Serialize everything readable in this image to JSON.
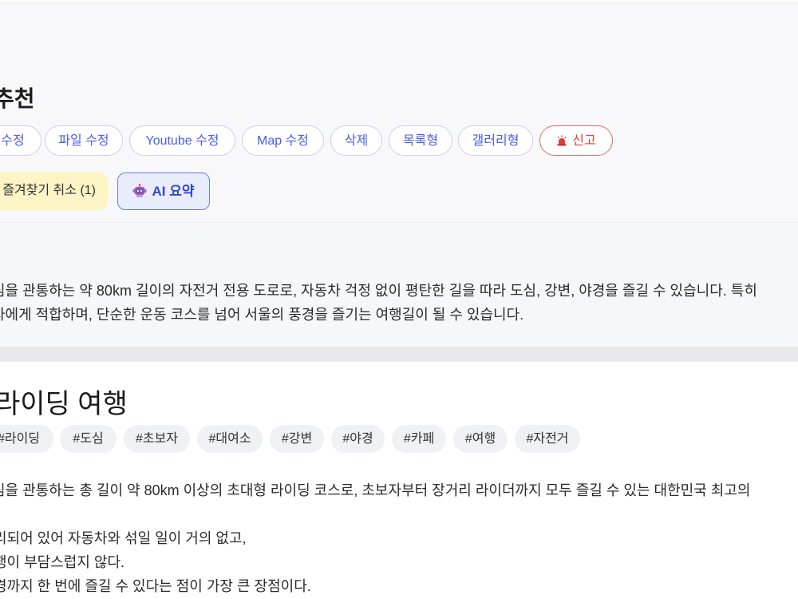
{
  "post": {
    "title": "추천"
  },
  "actions": [
    {
      "label": "수정",
      "style": "blue"
    },
    {
      "label": "파일 수정",
      "style": "blue"
    },
    {
      "label": "Youtube 수정",
      "style": "blue"
    },
    {
      "label": "Map 수정",
      "style": "blue"
    },
    {
      "label": "삭제",
      "style": "blue"
    },
    {
      "label": "목록형",
      "style": "blue"
    },
    {
      "label": "갤러리형",
      "style": "blue"
    },
    {
      "label": "신고",
      "style": "red",
      "icon": "siren-icon"
    }
  ],
  "favorite": {
    "label": "즐겨찾기 취소 (1)"
  },
  "ai_summary": {
    "label": "AI 요약",
    "icon": "robot-icon"
  },
  "summary_lines": [
    "심을 관통하는 약 80km 길이의 자전거 전용 도로로, 자동차 걱정 없이 평탄한 길을 따라 도심, 강변, 야경을 즐길 수 있습니다. 특히",
    "자에게 적합하며, 단순한 운동 코스를 넘어 서울의 풍경을 즐기는 여행길이 될 수 있습니다."
  ],
  "article": {
    "title": "라이딩 여행",
    "tags": [
      "#라이딩",
      "#도심",
      "#초보자",
      "#대여소",
      "#강변",
      "#야경",
      "#카페",
      "#여행",
      "#자전거"
    ],
    "lines": [
      "심을 관통하는 총 길이 약 80km 이상의 초대형 라이딩 코스로, 초보자부터 장거리 라이더까지 모두 즐길 수 있는 대한민국 최고의",
      "리되어 있어 자동차와 섞일 일이 거의 없고,",
      "행이 부담스럽지 않다.",
      "경까지 한 번에 즐길 수 있다는 점이 가장 큰 장점이다."
    ]
  },
  "colors": {
    "accent": "#4a5de8",
    "report": "#e23c3c",
    "favorite_bg": "#fdf4c6",
    "ai_bg": "#e9ecfb"
  }
}
